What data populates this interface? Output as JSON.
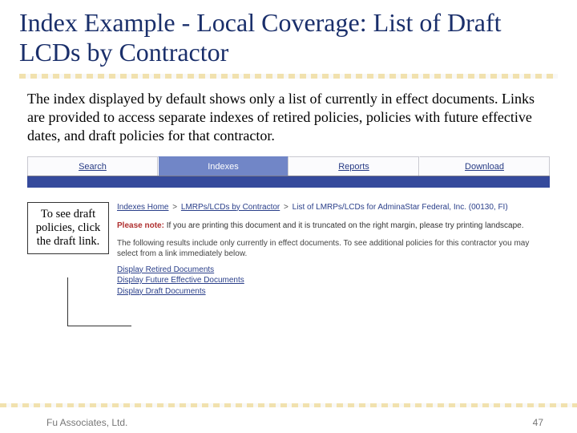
{
  "title": "Index Example - Local Coverage: List of Draft LCDs by Contractor",
  "body": "The index displayed by default shows only a list of currently in effect documents.  Links are provided to access separate indexes of retired policies, policies with future effective dates, and draft policies for that contractor.",
  "tabs": {
    "search": "Search",
    "indexes": "Indexes",
    "reports": "Reports",
    "download": "Download"
  },
  "callout": "To see draft policies, click the draft link.",
  "breadcrumb": {
    "a": "Indexes Home",
    "b": "LMRPs/LCDs by Contractor",
    "c": "List of LMRPs/LCDs for AdminaStar Federal, Inc. (00130, FI)"
  },
  "please_note_label": "Please note:",
  "please_note_text": "If you are printing this document and it is truncated on the right margin, please try printing landscape.",
  "note2": "The following results include only currently in effect documents. To see additional policies for this contractor you may select from a link immediately below.",
  "links": {
    "retired": "Display Retired Documents",
    "future": "Display Future Effective Documents",
    "draft": "Display Draft Documents"
  },
  "footer_left": "Fu Associates, Ltd.",
  "footer_right": "47"
}
